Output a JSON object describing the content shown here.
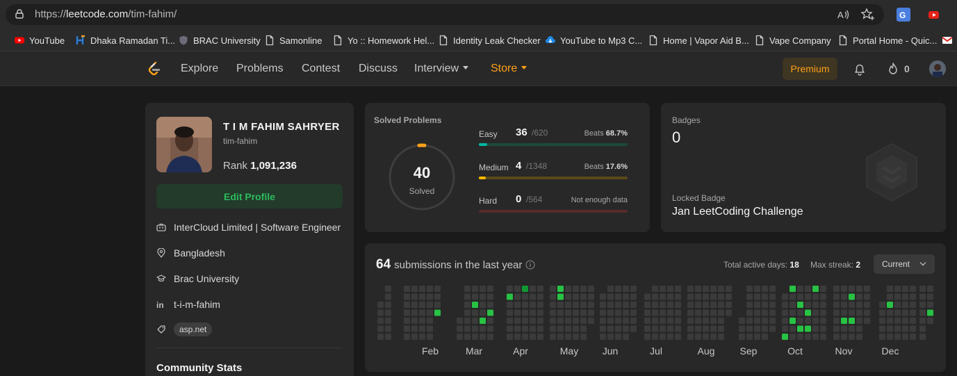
{
  "browser": {
    "url_prefix": "https://",
    "url_host": "leetcode.com",
    "url_path": "/tim-fahim/",
    "bookmarks": [
      {
        "label": "YouTube",
        "icon": "youtube-icon",
        "color": "#ff0000"
      },
      {
        "label": "Dhaka Ramadan Ti...",
        "icon": "h-logo-icon",
        "color": "#2a7bd6"
      },
      {
        "label": "BRAC University",
        "icon": "shield-icon",
        "color": "#6b6b7a"
      },
      {
        "label": "Samonline",
        "icon": "page-icon",
        "color": "#cfcfcf"
      },
      {
        "label": "Yo :: Homework Hel...",
        "icon": "page-icon",
        "color": "#cfcfcf"
      },
      {
        "label": "Identity Leak Checker",
        "icon": "page-icon",
        "color": "#cfcfcf"
      },
      {
        "label": "YouTube to Mp3 C...",
        "icon": "cloud-download-icon",
        "color": "#1e88e5"
      },
      {
        "label": "Home | Vapor Aid B...",
        "icon": "page-icon",
        "color": "#cfcfcf"
      },
      {
        "label": "Vape Company",
        "icon": "page-icon",
        "color": "#cfcfcf"
      },
      {
        "label": "Portal Home - Quic...",
        "icon": "page-icon",
        "color": "#cfcfcf"
      }
    ]
  },
  "nav": {
    "links": [
      "Explore",
      "Problems",
      "Contest",
      "Discuss"
    ],
    "interview": "Interview",
    "store": "Store",
    "premium": "Premium",
    "streak": "0"
  },
  "profile": {
    "name": "T I M FAHIM SAHRYER",
    "username": "tim-fahim",
    "rank_label": "Rank",
    "rank_value": "1,091,236",
    "edit_label": "Edit Profile",
    "work": "InterCloud Limited | Software Engineer",
    "location": "Bangladesh",
    "school": "Brac University",
    "linkedin": "t-i-m-fahim",
    "skill": "asp.net",
    "community_title": "Community Stats"
  },
  "solved": {
    "title": "Solved Problems",
    "total": "40",
    "label": "Solved",
    "difficulties": [
      {
        "name": "Easy",
        "count": "36",
        "total": "/620",
        "beats_label": "Beats",
        "beats_value": "68.7%",
        "fill": 0.058,
        "color": "#00b8a3",
        "track": "#1b4a3a"
      },
      {
        "name": "Medium",
        "count": "4",
        "total": "/1348",
        "beats_label": "Beats",
        "beats_value": "17.6%",
        "fill": 0.003,
        "color": "#ffb800",
        "track": "#5a4a1a"
      },
      {
        "name": "Hard",
        "count": "0",
        "total": "/564",
        "beats_label": "Not enough data",
        "beats_value": "",
        "fill": 0,
        "color": "#ef4743",
        "track": "#5a2a2a"
      }
    ]
  },
  "badges": {
    "title": "Badges",
    "count": "0",
    "locked_label": "Locked Badge",
    "locked_name": "Jan LeetCoding Challenge"
  },
  "submissions": {
    "count": "64",
    "text": "submissions in the last year",
    "active_label": "Total active days:",
    "active_value": "18",
    "streak_label": "Max streak:",
    "streak_value": "2",
    "select": "Current",
    "months": [
      "Feb",
      "Mar",
      "Apr",
      "May",
      "Jun",
      "Jul",
      "Aug",
      "Sep",
      "Oct",
      "Nov",
      "Dec"
    ]
  }
}
